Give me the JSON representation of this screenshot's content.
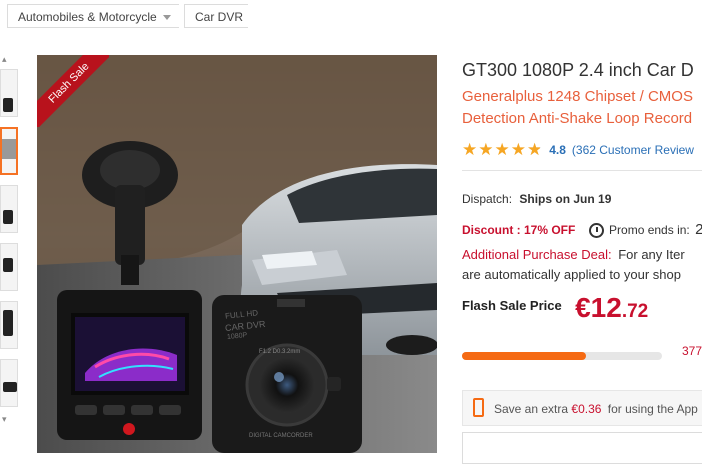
{
  "breadcrumb": {
    "items": [
      "Automobiles & Motorcycle",
      "Car DVR"
    ]
  },
  "product": {
    "flash_badge": "Flash Sale",
    "title": "GT300 1080P 2.4 inch Car D",
    "subtitle_line1": "Generalplus 1248 Chipset / CMOS",
    "subtitle_line2": "Detection Anti-Shake Loop Record",
    "image_text": {
      "cam_right_line1": "FULL HD",
      "cam_right_line2": "CAR DVR",
      "cam_right_line3": "1080P",
      "lens_ring": "F1.2 D0.3.2mm",
      "camcorder": "DIGITAL CAMCORDER"
    }
  },
  "rating": {
    "stars_value": 4.8,
    "score": "4.8",
    "reviews": "(362 Customer Review"
  },
  "dispatch": {
    "label": "Dispatch:",
    "value": "Ships on Jun 19"
  },
  "discount": {
    "label": "Discount : 17% OFF",
    "promo_label": "Promo ends in:",
    "promo_value": "2"
  },
  "additional": {
    "label": "Additional Purchase Deal:",
    "text1": "For any Iter",
    "text2": "are automatically applied to your shop"
  },
  "price": {
    "label": "Flash Sale Price",
    "currency": "€",
    "integer": "12",
    "decimal": ".72"
  },
  "sold": {
    "progress": 0.62,
    "count": "377"
  },
  "app_save": {
    "prefix": "Save an extra",
    "amount": "€0.36",
    "suffix": "for using the App"
  },
  "colors": {
    "accent": "#f56a13",
    "price_red": "#c8102e",
    "subtitle": "#e8603c",
    "link": "#2a6fb6",
    "star": "#f6a623"
  }
}
